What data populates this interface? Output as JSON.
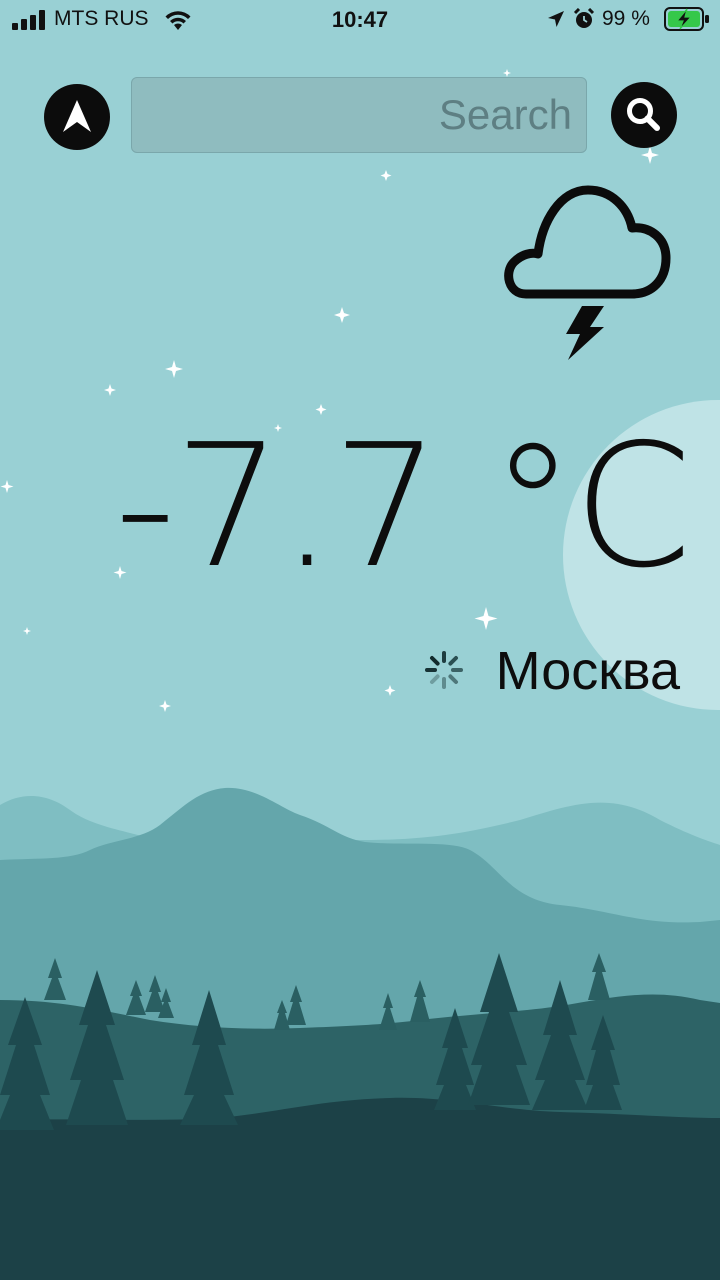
{
  "status_bar": {
    "carrier": "MTS RUS",
    "time": "10:47",
    "battery_percent": "99 %",
    "icons": [
      "cellular-signal-icon",
      "wifi-icon",
      "location-arrow-icon",
      "alarm-clock-icon",
      "battery-charging-icon"
    ]
  },
  "search": {
    "placeholder": "Search",
    "value": ""
  },
  "buttons": {
    "locate": "navigation-arrow-icon",
    "search": "magnifier-icon"
  },
  "weather": {
    "condition_icon": "cloud-lightning-icon",
    "temperature": "-7.7 °C",
    "city": "Москва",
    "loading_icon": "spinner-icon"
  },
  "colors": {
    "sky": "#99d0d4",
    "moon": "#bfe3e6",
    "hills_far": "#7fbec2",
    "hills_mid": "#64a6ab",
    "hills_near": "#2d6366",
    "ground": "#1c4147",
    "trees_back": "#2a5f62",
    "trees_front": "#1e4a4f",
    "battery_fill": "#35c84a"
  }
}
